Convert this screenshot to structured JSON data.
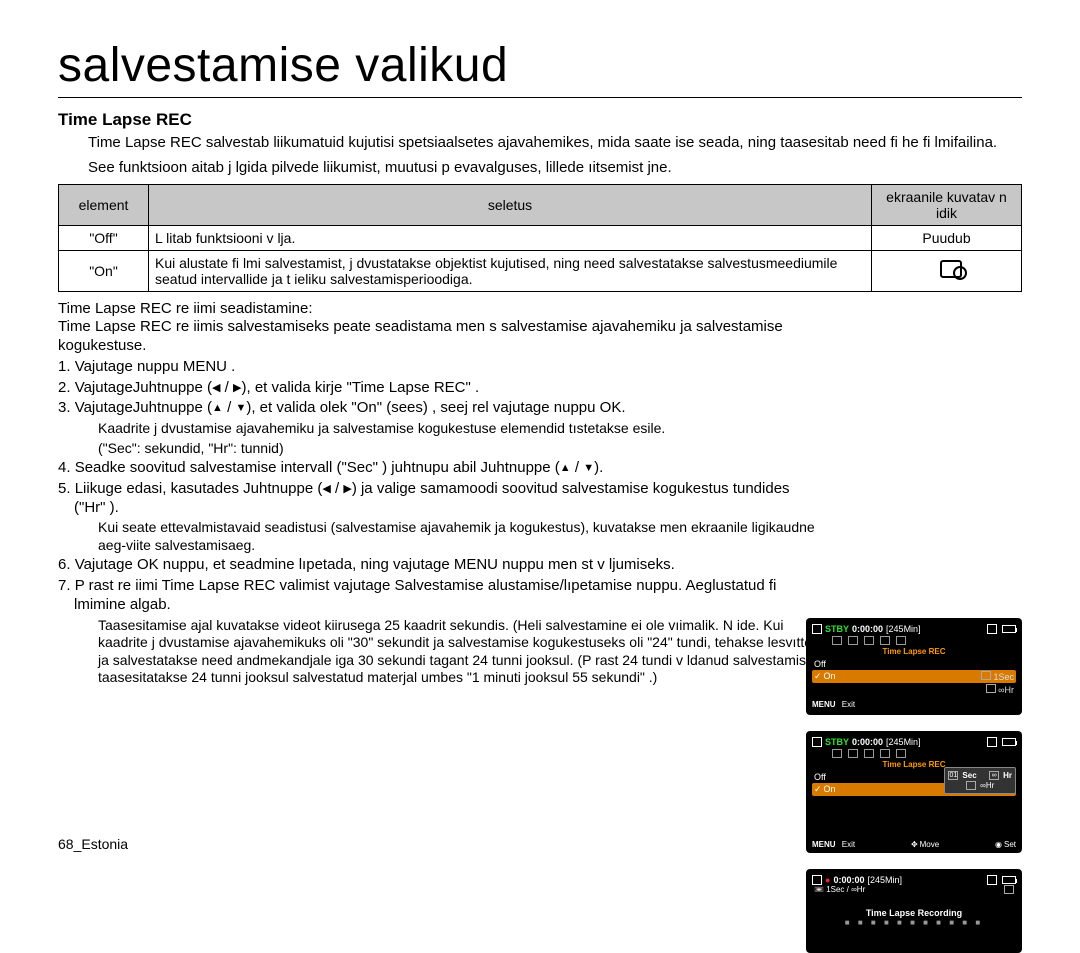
{
  "title": "salvestamise valikud",
  "section": "Time Lapse REC",
  "intro1": "Time Lapse REC salvestab liikumatuid kujutisi spetsiaalsetes ajavahemikes, mida saate ise seada, ning taasesitab need ﬁ he ﬁ lmifailina.",
  "intro2": "See funktsioon aitab j lgida pilvede liikumist, muutusi p evavalguses, lillede ıitsemist jne.",
  "table": {
    "h1": "element",
    "h2": "seletus",
    "h3": "ekraanile kuvatav n idik",
    "r1c1": "\"Off\"",
    "r1c2": "L litab funktsiooni v lja.",
    "r1c3": "Puudub",
    "r2c1": "\"On\"",
    "r2c2": "Kui alustate ﬁ lmi salvestamist, j dvustatakse objektist kujutised, ning need salvestatakse salvestusmeediumile seatud intervallide ja t ieliku salvestamisperioodiga."
  },
  "setupTitle": "Time Lapse REC re iimi seadistamine:",
  "setupIntro": "Time Lapse REC re iimis salvestamiseks peate seadistama men s salvestamise ajavahemiku ja salvestamise kogukestuse.",
  "step1": "Vajutage nuppu MENU .",
  "step2a": "VajutageJuhtnuppe  (",
  "step2b": "),  et valida kirje \"Time Lapse REC\" .",
  "step3a": "VajutageJuhtnuppe  (",
  "step3b": "), et valida olek \"On\"  (sees) , seej rel vajutage nuppu OK.",
  "note3a": "Kaadrite j dvustamise ajavahemiku ja salvestamise kogukestuse elemendid tıstetakse esile.",
  "note3b": "(\"Sec\":  sekundid, \"Hr\":  tunnid)",
  "step4a": "Seadke soovitud salvestamise intervall (\"Sec\" ) juhtnupu abil Juhtnuppe  (",
  "step4b": ").",
  "step5a": "Liikuge edasi, kasutades Juhtnuppe  (",
  "step5b": ") ja valige samamoodi soovitud salvestamise kogukestus tundides (\"Hr\" ).",
  "note5": "Kui seate ettevalmistavaid seadistusi (salvestamise ajavahemik ja kogukestus), kuvatakse men  ekraanile ligikaudne aeg-viite salvestamisaeg.",
  "step6": "Vajutage OK nuppu, et seadmine lıpetada, ning vajutage MENU nuppu men st v ljumiseks.",
  "step7": "P rast re iimi Time Lapse REC valimist vajutage Salvestamise alustamise/lıpetamise      nuppu. Aeglustatud ﬁ lmimine algab.",
  "note7": "Taasesitamise ajal kuvatakse videot kiirusega 25 kaadrit sekundis. (Heli salvestamine ei ole vıimalik. N ide. Kui kaadrite j dvustamise ajavahemikuks oli \"30\"  sekundit ja salvestamise kogukestuseks oli \"24\"  tundi, tehakse  lesvıtteid ja salvestatakse need andmekandjale iga 30 sekundi tagant 24 tunni jooksul. (P rast 24 tundi v ldanud salvestamist taasesitatakse 24 tunni jooksul salvestatud materjal umbes \"1 minuti jooksul 55 sekundi\" .)",
  "lcd": {
    "stby": "STBY",
    "time": "0:00:00",
    "remain": "[245Min]",
    "menu": "Time Lapse REC",
    "off": "Off",
    "on": "On",
    "right1": "1Sec",
    "right2": "∞Hr",
    "sechr": "1Sec / ∞Hr",
    "exit": "Exit",
    "move": "Move",
    "set": "Set",
    "MENU": "MENU",
    "sec": "Sec",
    "hr": "Hr",
    "sq01": "01",
    "sqinf": "∞",
    "tlr": "Time Lapse Recording"
  },
  "footer": "68_Estonia"
}
